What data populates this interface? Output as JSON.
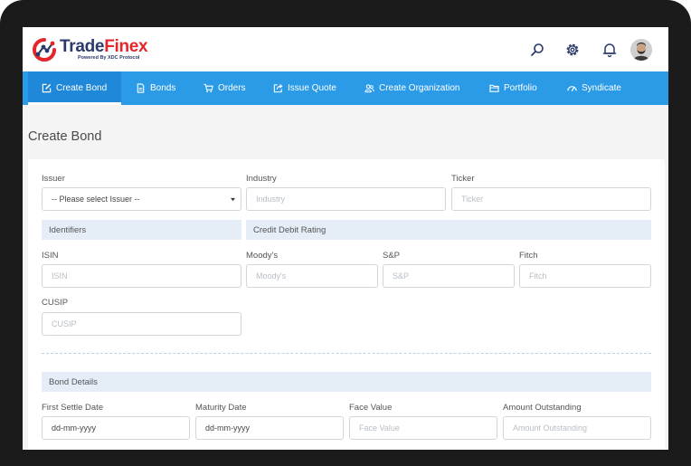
{
  "brand": {
    "name_part1": "Trade",
    "name_part2": "Finex",
    "tagline": "Powered By XDC Protocol",
    "accent_color": "#2b9be8",
    "logo_red": "#e3262b",
    "logo_navy": "#2a3a6b"
  },
  "header": {
    "icons": [
      "search-icon",
      "gear-icon",
      "bell-icon",
      "user-avatar"
    ]
  },
  "nav": {
    "items": [
      {
        "label": "Create Bond",
        "icon": "edit-icon",
        "active": true
      },
      {
        "label": "Bonds",
        "icon": "document-icon",
        "active": false
      },
      {
        "label": "Orders",
        "icon": "cart-icon",
        "active": false
      },
      {
        "label": "Issue Quote",
        "icon": "share-icon",
        "active": false
      },
      {
        "label": "Create Organization",
        "icon": "users-icon",
        "active": false
      },
      {
        "label": "Portfolio",
        "icon": "folder-icon",
        "active": false
      },
      {
        "label": "Syndicate",
        "icon": "gauge-icon",
        "active": false
      }
    ]
  },
  "page": {
    "title": "Create Bond"
  },
  "form": {
    "issuer": {
      "label": "Issuer",
      "value": "-- Please select Issuer --"
    },
    "industry": {
      "label": "Industry",
      "placeholder": "Industry"
    },
    "ticker": {
      "label": "Ticker",
      "placeholder": "Ticker"
    },
    "identifiers_section": "Identifiers",
    "rating_section": "Credit Debit Rating",
    "isin": {
      "label": "ISIN",
      "placeholder": "ISIN"
    },
    "moodys": {
      "label": "Moody's",
      "placeholder": "Moody's"
    },
    "sp": {
      "label": "S&P",
      "placeholder": "S&P"
    },
    "fitch": {
      "label": "Fitch",
      "placeholder": "Fitch"
    },
    "cusip": {
      "label": "CUSIP",
      "placeholder": "CUSIP"
    },
    "bond_details_section": "Bond Details",
    "first_settle_date": {
      "label": "First Settle Date",
      "value": "dd-mm-yyyy"
    },
    "maturity_date": {
      "label": "Maturity Date",
      "value": "dd-mm-yyyy"
    },
    "face_value": {
      "label": "Face Value",
      "placeholder": "Face Value"
    },
    "amount_outstanding": {
      "label": "Amount Outstanding",
      "placeholder": "Amount Outstanding"
    }
  }
}
